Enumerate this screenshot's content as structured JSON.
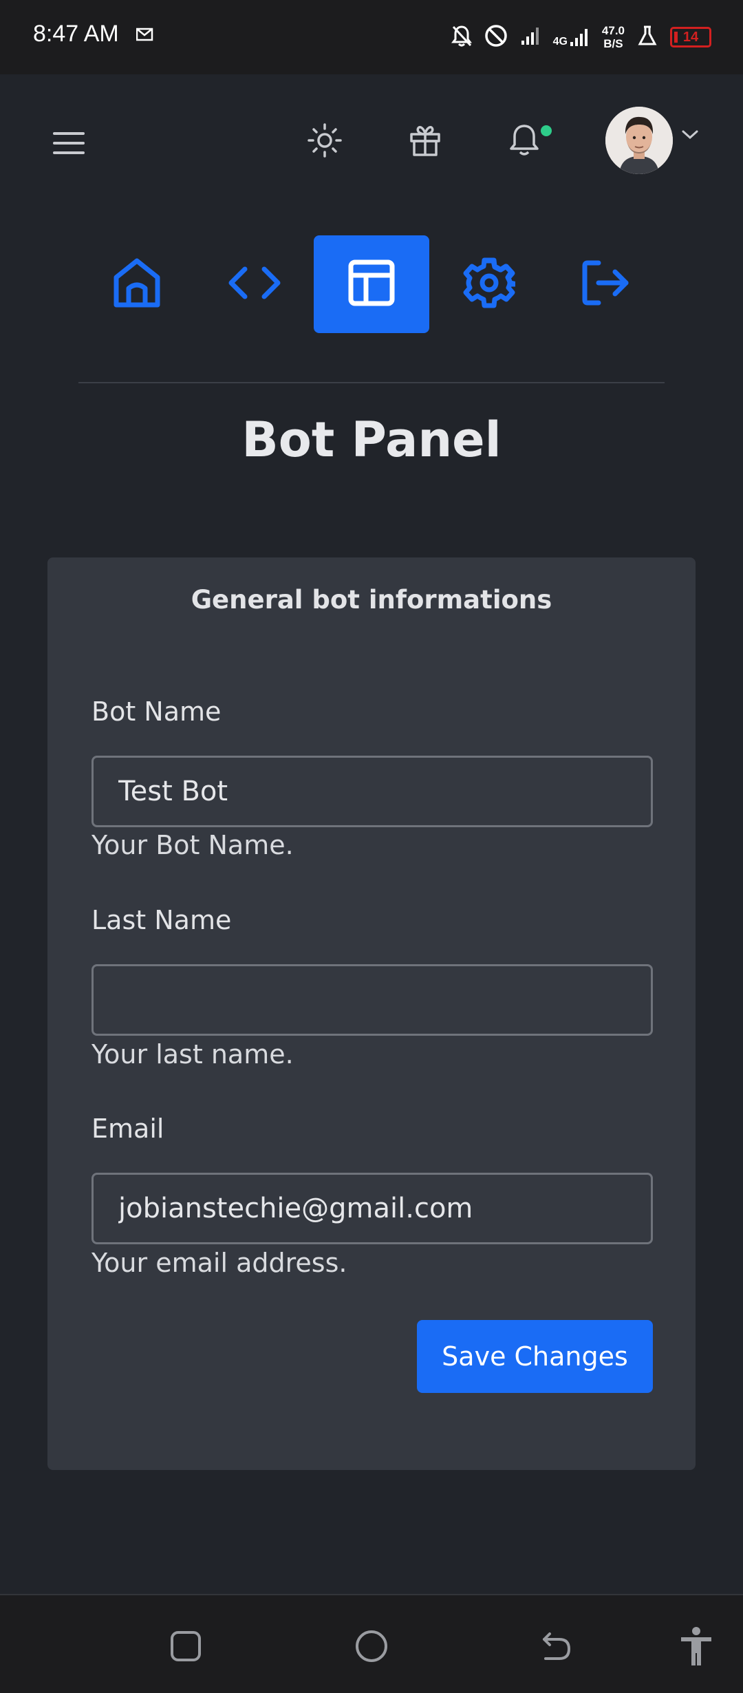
{
  "status_bar": {
    "time": "8:47 AM",
    "network": "4G",
    "speed_value": "47.0",
    "speed_unit": "B/S",
    "battery": "14",
    "icons": [
      "mail-icon",
      "bell-off-icon",
      "dnd-icon",
      "signal-icon",
      "signal-4g-icon",
      "flask-icon",
      "battery-icon"
    ]
  },
  "header": {
    "icons": [
      "menu-icon",
      "sun-icon",
      "gift-icon",
      "bell-icon",
      "avatar",
      "chevron-down-icon"
    ],
    "notification_dot_color": "#2ecc8a"
  },
  "nav": {
    "items": [
      {
        "name": "home",
        "icon": "home-icon",
        "active": false
      },
      {
        "name": "code",
        "icon": "code-icon",
        "active": false
      },
      {
        "name": "layout",
        "icon": "layout-icon",
        "active": true
      },
      {
        "name": "settings",
        "icon": "gear-icon",
        "active": false
      },
      {
        "name": "logout",
        "icon": "logout-icon",
        "active": false
      }
    ],
    "accent_color": "#1a6cf5"
  },
  "page": {
    "title": "Bot Panel"
  },
  "card": {
    "title": "General bot informations",
    "fields": [
      {
        "label": "Bot Name",
        "value": "Test Bot",
        "help": "Your Bot Name."
      },
      {
        "label": "Last Name",
        "value": "",
        "help": "Your last name."
      },
      {
        "label": "Email",
        "value": "jobianstechie@gmail.com",
        "help": "Your email address."
      }
    ],
    "save_label": "Save Changes"
  },
  "system_nav": {
    "icons": [
      "recents-icon",
      "home-circle-icon",
      "back-icon",
      "accessibility-icon"
    ]
  }
}
